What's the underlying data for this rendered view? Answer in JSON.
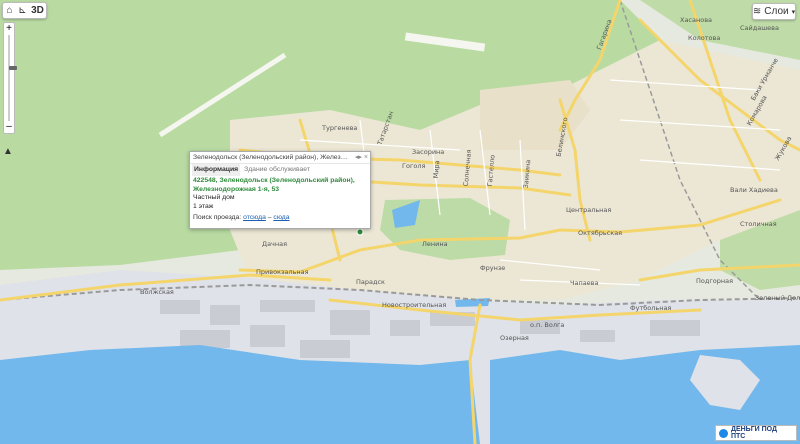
{
  "toolbar": {
    "logo_icon": "home-icon",
    "measure_icon": "ruler-icon",
    "view_3d": "3D"
  },
  "layers": {
    "label": "Слои",
    "icon": "layers-icon"
  },
  "zoom": {
    "plus": "+",
    "minus": "–",
    "level": 0.62
  },
  "compass": {
    "icon": "north-arrow-icon"
  },
  "popup": {
    "title": "Зеленодольск (Зеленодольский район), Железнодорож...",
    "tab_info": "Информация",
    "tab_service": "Здание обслуживает",
    "address": "422548, Зеленодольск (Зеленодольский район), Железнодорожная 1-я, 53",
    "building_type": "Частный дом",
    "floors": "1 этаж",
    "route_prefix": "Поиск проезда:",
    "route_from": "отсюда",
    "route_sep": "–",
    "route_to": "сюда"
  },
  "streets": [
    "Хасанова",
    "Колотова",
    "Сайдашева",
    "Гагарина",
    "Тургенева",
    "Татарстан",
    "Засорина",
    "Гоголя",
    "Мира",
    "Солнечная",
    "Гастелло",
    "Заикина",
    "Белинского",
    "Центральная",
    "Октябрьская",
    "Ленина",
    "Фрунзе",
    "Чапаева",
    "Привокзальная",
    "Волжская",
    "Новостроительная",
    "Парадск",
    "Футбольная",
    "Озерная",
    "Подгорная",
    "Столичная",
    "Комарова",
    "Жукова",
    "Вали Хадиева",
    "Баки Урманче",
    "Дачная",
    "о.п. Волга",
    "Зеленый Дол"
  ],
  "ad": {
    "label": "ДЕНЬГИ ПОД ПТС",
    "icon": "brand-logo-icon"
  },
  "colors": {
    "water": "#73b8ec",
    "forest": "#b9dba2",
    "urban": "#e8e4d8",
    "industrial": "#e1e3e8",
    "road": "#f4d56b",
    "railway": "#9a9a9a",
    "popup_address": "#2e8b3a",
    "link": "#1b5fb3"
  }
}
